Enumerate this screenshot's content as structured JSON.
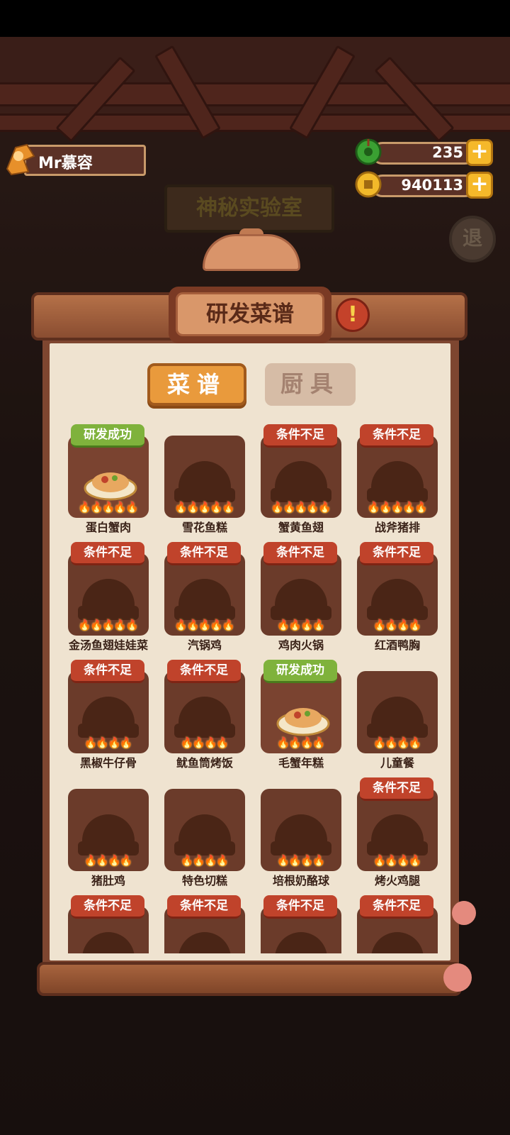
{
  "player": {
    "name": "Mr慕容"
  },
  "currency": {
    "jade": "235",
    "coins": "940113",
    "plus_symbol": "+"
  },
  "background": {
    "lab_title": "神秘实验室",
    "exit_label": "退"
  },
  "panel": {
    "title": "研发菜谱",
    "info_symbol": "!",
    "tabs": [
      {
        "label": "菜谱",
        "active": true
      },
      {
        "label": "厨具",
        "active": false
      }
    ]
  },
  "recipes": [
    {
      "name": "蛋白蟹肉",
      "status": "研发成功",
      "state": "success",
      "flames": 5
    },
    {
      "name": "雪花鱼糕",
      "status": "",
      "state": "none",
      "flames": 5
    },
    {
      "name": "蟹黄鱼翅",
      "status": "条件不足",
      "state": "fail",
      "flames": 5
    },
    {
      "name": "战斧猪排",
      "status": "条件不足",
      "state": "fail",
      "flames": 5
    },
    {
      "name": "金汤鱼翅娃娃菜",
      "status": "条件不足",
      "state": "fail",
      "flames": 5
    },
    {
      "name": "汽锅鸡",
      "status": "条件不足",
      "state": "fail",
      "flames": 5
    },
    {
      "name": "鸡肉火锅",
      "status": "条件不足",
      "state": "fail",
      "flames": 4
    },
    {
      "name": "红酒鸭胸",
      "status": "条件不足",
      "state": "fail",
      "flames": 4
    },
    {
      "name": "黑椒牛仔骨",
      "status": "条件不足",
      "state": "fail",
      "flames": 4
    },
    {
      "name": "鱿鱼筒烤饭",
      "status": "条件不足",
      "state": "fail",
      "flames": 4
    },
    {
      "name": "毛蟹年糕",
      "status": "研发成功",
      "state": "success",
      "flames": 4
    },
    {
      "name": "儿童餐",
      "status": "",
      "state": "none",
      "flames": 4
    },
    {
      "name": "猪肚鸡",
      "status": "",
      "state": "none",
      "flames": 4
    },
    {
      "name": "特色切糕",
      "status": "",
      "state": "none",
      "flames": 4
    },
    {
      "name": "培根奶酪球",
      "status": "",
      "state": "none",
      "flames": 4
    },
    {
      "name": "烤火鸡腿",
      "status": "条件不足",
      "state": "fail",
      "flames": 4
    },
    {
      "name": "",
      "status": "条件不足",
      "state": "fail",
      "flames": 0
    },
    {
      "name": "",
      "status": "条件不足",
      "state": "fail",
      "flames": 0
    },
    {
      "name": "",
      "status": "条件不足",
      "state": "fail",
      "flames": 0
    },
    {
      "name": "",
      "status": "条件不足",
      "state": "fail",
      "flames": 0
    }
  ],
  "colors": {
    "success": "#7fb23c",
    "fail": "#c0432b",
    "flame": "#ff6a1a"
  }
}
